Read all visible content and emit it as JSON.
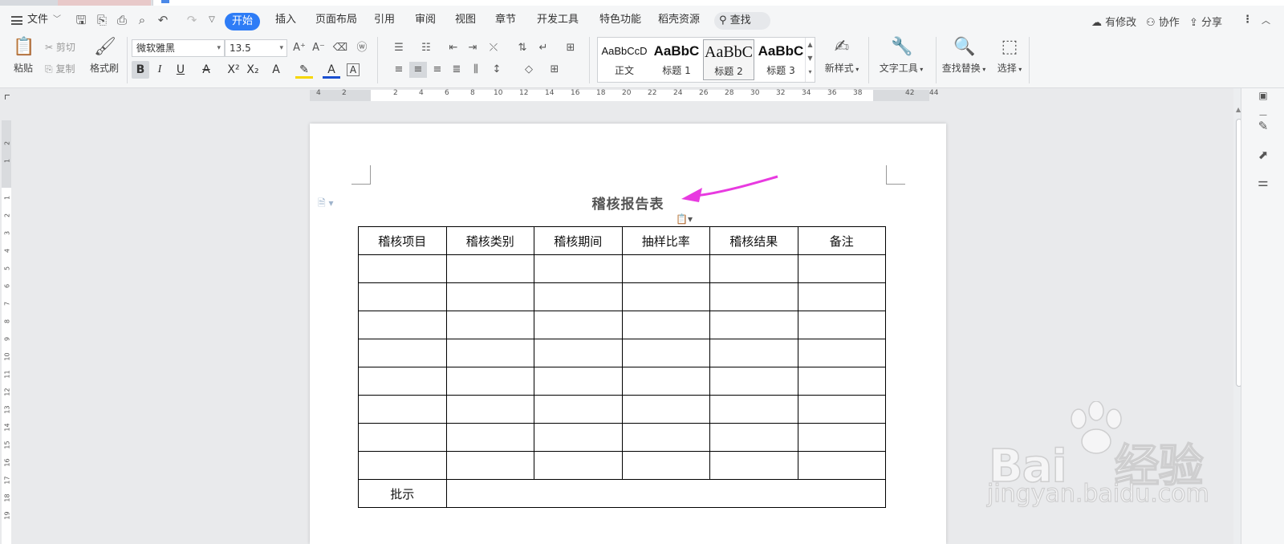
{
  "menubar": {
    "file_label": "文件",
    "tabs": [
      "开始",
      "插入",
      "页面布局",
      "引用",
      "审阅",
      "视图",
      "章节",
      "开发工具",
      "特色功能",
      "稻壳资源"
    ],
    "search_label": "查找",
    "right": {
      "modified": "有修改",
      "collab": "协作",
      "share": "分享"
    }
  },
  "ribbon": {
    "paste": "粘贴",
    "cut": "剪切",
    "copy": "复制",
    "format_painter": "格式刷",
    "font_name": "微软雅黑",
    "font_size": "13.5",
    "styles": [
      {
        "sample": "AaBbCcD",
        "name": "正文"
      },
      {
        "sample": "AaBbC",
        "name": "标题 1"
      },
      {
        "sample": "AaBbC",
        "name": "标题 2"
      },
      {
        "sample": "AaBbC",
        "name": "标题 3"
      }
    ],
    "new_style": "新样式",
    "text_tools": "文字工具",
    "find_replace": "查找替换",
    "select": "选择"
  },
  "ruler": {
    "h_numbers": [
      "4",
      "2",
      "2",
      "4",
      "6",
      "8",
      "10",
      "12",
      "14",
      "16",
      "18",
      "20",
      "22",
      "24",
      "26",
      "28",
      "30",
      "32",
      "34",
      "36",
      "38",
      "42",
      "44"
    ],
    "v_numbers": [
      "2",
      "1",
      "1",
      "2",
      "3",
      "4",
      "5",
      "6",
      "7",
      "8",
      "9",
      "10",
      "11",
      "12",
      "13",
      "14",
      "15",
      "16",
      "17",
      "18",
      "19"
    ]
  },
  "document": {
    "title": "稽核报告表",
    "table": {
      "headers": [
        "稽核项目",
        "稽核类别",
        "稽核期间",
        "抽样比率",
        "稽核结果",
        "备注"
      ],
      "empty_rows": 8,
      "footer_label": "批示"
    }
  },
  "watermark": {
    "brand": "Bai",
    "brand2": "经验",
    "url": "jingyan.baidu.com"
  },
  "colors": {
    "accent": "#2e7cf6",
    "arrow": "#e83ae0"
  }
}
